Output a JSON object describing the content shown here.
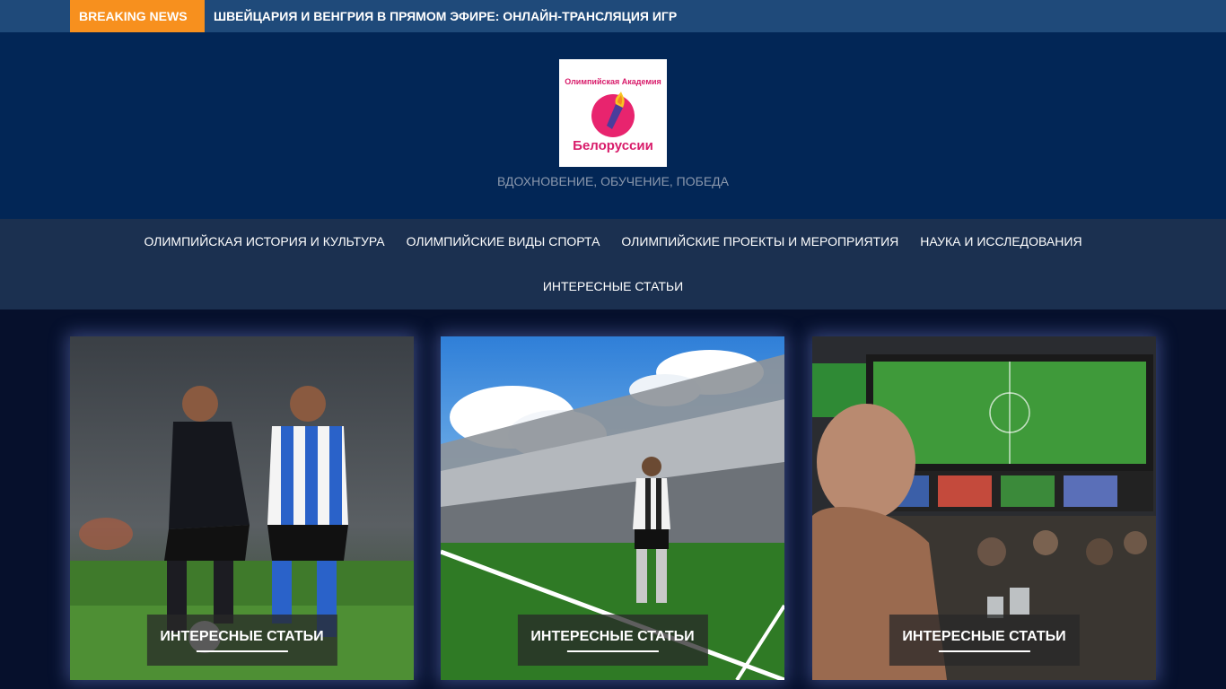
{
  "breaking": {
    "label": "BREAKING NEWS",
    "headline": "ШВЕЙЦАРИЯ И ВЕНГРИЯ В ПРЯМОМ ЭФИРЕ: ОНЛАЙН-ТРАНСЛЯЦИЯ ИГР"
  },
  "header": {
    "logo_top_text": "Олимпийская Академия",
    "logo_bottom_text": "Белоруссии",
    "tagline": "ВДОХНОВЕНИЕ, ОБУЧЕНИЕ, ПОБЕДА"
  },
  "nav": {
    "items": [
      "ОЛИМПИЙСКАЯ ИСТОРИЯ И КУЛЬТУРА",
      "ОЛИМПИЙСКИЕ ВИДЫ СПОРТА",
      "ОЛИМПИЙСКИЕ ПРОЕКТЫ И МЕРОПРИЯТИЯ",
      "НАУКА И ИССЛЕДОВАНИЯ",
      "ИНТЕРЕСНЫЕ СТАТЬИ"
    ]
  },
  "cards": [
    {
      "category": "ИНТЕРЕСНЫЕ СТАТЬИ"
    },
    {
      "category": "ИНТЕРЕСНЫЕ СТАТЬИ"
    },
    {
      "category": "ИНТЕРЕСНЫЕ СТАТЬИ"
    }
  ],
  "colors": {
    "topbar": "#1f4a7a",
    "breaking_accent": "#f7901e",
    "header_bg": "#022656",
    "nav_bg": "#1b3050",
    "page_bg": "#06102c",
    "logo_pink": "#d81b6a"
  }
}
